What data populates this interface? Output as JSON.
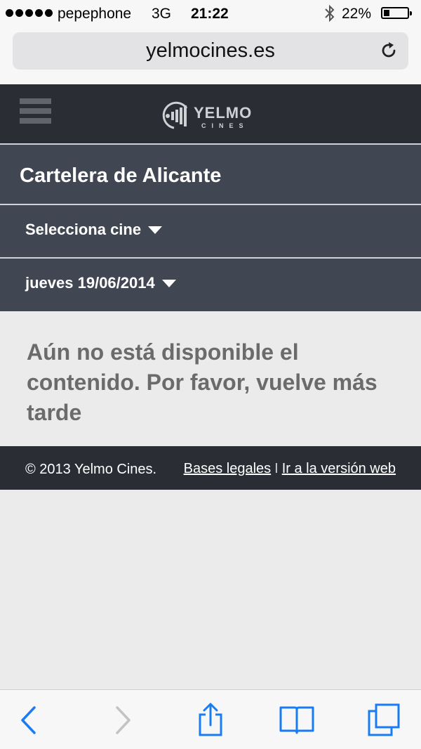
{
  "status_bar": {
    "carrier": "pepephone",
    "network": "3G",
    "time": "21:22",
    "battery_percent": "22%",
    "battery_level": 0.22,
    "signal_dots": 5
  },
  "browser": {
    "url": "yelmocines.es",
    "reload_icon": "reload-icon"
  },
  "site": {
    "brand": "YELMO",
    "brand_sub": "CINES",
    "menu_icon": "hamburger-menu-icon"
  },
  "page": {
    "title": "Cartelera de Alicante",
    "cinema_select": "Selecciona cine",
    "date_select": "jueves 19/06/2014",
    "message": "Aún no está disponible el contenido. Por favor, vuelve más tarde"
  },
  "footer": {
    "copyright": "© 2013 Yelmo Cines.",
    "legal_link": "Bases legales",
    "separator": "I",
    "web_link": "Ir a la versión web"
  },
  "toolbar": {
    "icons": [
      "back-icon",
      "forward-icon",
      "share-icon",
      "bookmarks-icon",
      "tabs-icon"
    ],
    "accent_color": "#1a7cf5",
    "disabled_color": "#c3c3c6"
  }
}
